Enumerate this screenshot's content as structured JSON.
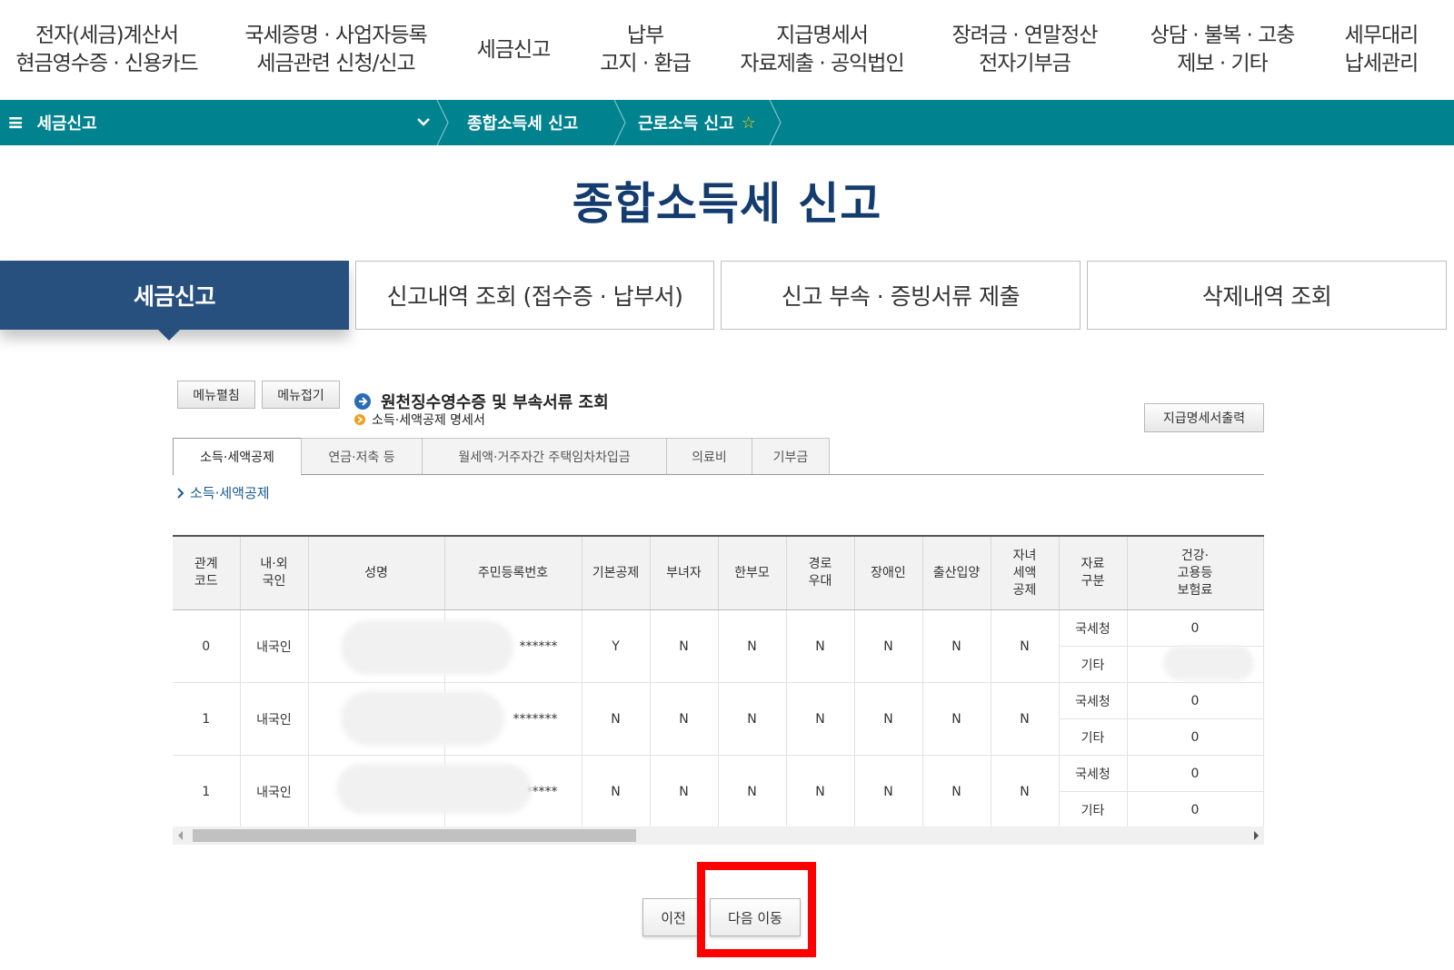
{
  "gnb": {
    "items": [
      {
        "line1": "전자(세금)계산서",
        "line2": "현금영수증 · 신용카드"
      },
      {
        "line1": "국세증명 · 사업자등록",
        "line2": "세금관련 신청/신고"
      },
      {
        "line1": "세금신고",
        "line2": ""
      },
      {
        "line1": "납부",
        "line2": "고지 · 환급"
      },
      {
        "line1": "지급명세서",
        "line2": "자료제출 · 공익법인"
      },
      {
        "line1": "장려금 · 연말정산",
        "line2": "전자기부금"
      },
      {
        "line1": "상담 · 불복 · 고충",
        "line2": "제보 · 기타"
      },
      {
        "line1": "세무대리",
        "line2": "납세관리"
      }
    ]
  },
  "lnb": {
    "menu_icon": "≡",
    "menu_label": "세금신고",
    "crumbs": [
      "종합소득세 신고",
      "근로소득 신고"
    ],
    "favorite_icon": "☆",
    "accent": "#00828f"
  },
  "page_title": "종합소득세 신고",
  "main_tabs": [
    "세금신고",
    "신고내역 조회 (접수증 · 납부서)",
    "신고 부속 · 증빙서류 제출",
    "삭제내역 조회"
  ],
  "buttons": {
    "menu_expand": "메뉴펼침",
    "menu_collapse": "메뉴접기",
    "print_statement": "지급명세서출력",
    "prev": "이전",
    "next": "다음 이동"
  },
  "section": {
    "title": "원천징수영수증 및 부속서류 조회",
    "subtitle": "소득·세액공제 명세서"
  },
  "sub_tabs": [
    "소득·세액공제",
    "연금·저축 등",
    "월세액·거주자간 주택임차차입금",
    "의료비",
    "기부금"
  ],
  "sub_crumb": "소득·세액공제",
  "table": {
    "headers": [
      [
        "관계",
        "코드"
      ],
      [
        "내·외",
        "국인"
      ],
      [
        "성명"
      ],
      [
        "주민등록번호"
      ],
      [
        "기본공제"
      ],
      [
        "부녀자"
      ],
      [
        "한부모"
      ],
      [
        "경로",
        "우대"
      ],
      [
        "장애인"
      ],
      [
        "출산입양"
      ],
      [
        "자녀",
        "세액",
        "공제"
      ],
      [
        "자료",
        "구분"
      ],
      [
        "건강·",
        "고용등",
        "보험료"
      ]
    ],
    "rows": [
      {
        "code": "0",
        "nationality": "내국인",
        "name": "",
        "rrn": "******",
        "basic": "Y",
        "woman": "N",
        "single_parent": "N",
        "elderly": "N",
        "disabled": "N",
        "birth_adopt": "N",
        "child_credit": "N",
        "sources": [
          {
            "type": "국세청",
            "insurance": "0"
          },
          {
            "type": "기타",
            "insurance": ""
          }
        ]
      },
      {
        "code": "1",
        "nationality": "내국인",
        "name": "",
        "rrn": "*******",
        "basic": "N",
        "woman": "N",
        "single_parent": "N",
        "elderly": "N",
        "disabled": "N",
        "birth_adopt": "N",
        "child_credit": "N",
        "sources": [
          {
            "type": "국세청",
            "insurance": "0"
          },
          {
            "type": "기타",
            "insurance": "0"
          }
        ]
      },
      {
        "code": "1",
        "nationality": "내국인",
        "name": "",
        "rrn": "*****",
        "basic": "N",
        "woman": "N",
        "single_parent": "N",
        "elderly": "N",
        "disabled": "N",
        "birth_adopt": "N",
        "child_credit": "N",
        "sources": [
          {
            "type": "국세청",
            "insurance": "0"
          },
          {
            "type": "기타",
            "insurance": "0"
          }
        ]
      }
    ]
  },
  "colors": {
    "title": "#143c6e",
    "active_tab": "#27507f",
    "highlight": "#ff0000"
  }
}
